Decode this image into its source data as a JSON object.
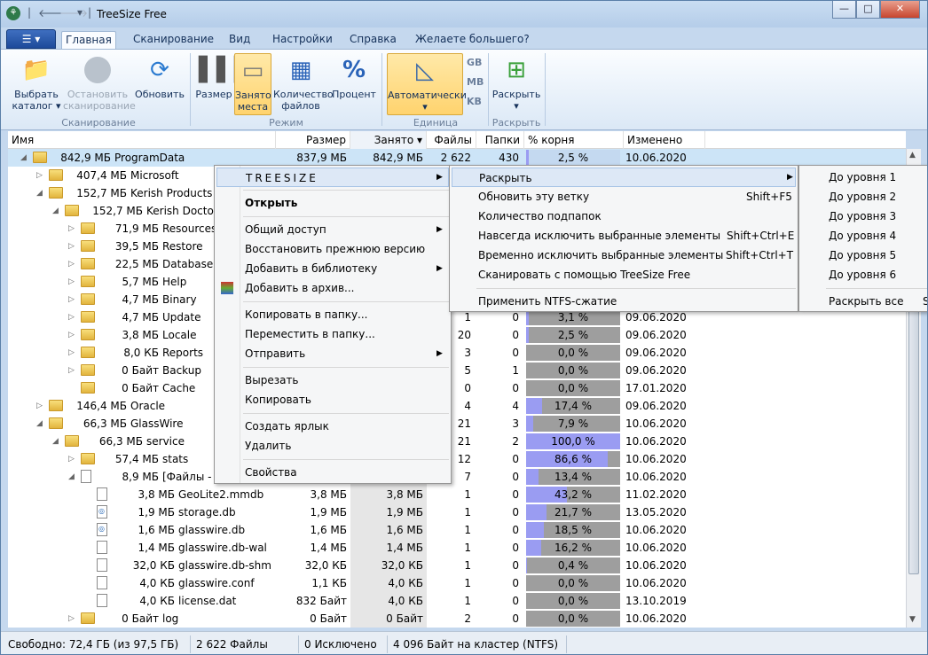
{
  "window": {
    "title": "TreeSize Free",
    "controls": {
      "minimize": "—",
      "maximize": "□",
      "close": "✕"
    }
  },
  "tabs": {
    "file": "☰ ▾",
    "items": [
      "Главная",
      "Сканирование",
      "Вид",
      "Настройки",
      "Справка",
      "Желаете большего?"
    ]
  },
  "ribbon": {
    "select": "Выбрать\nкаталог ▾",
    "stop": "Остановить\nсканирование",
    "refresh": "Обновить",
    "size": "Размер",
    "used": "Занято\nместа",
    "filecount": "Количество\nфайлов",
    "percent": "Процент",
    "auto": "Автоматически\n▾",
    "units": [
      "GB",
      "MB",
      "KB"
    ],
    "expand": "Раскрыть\n▾",
    "groups": {
      "scan": "Сканирование",
      "mode": "Режим",
      "unit": "Единица",
      "expand": "Раскрыть"
    }
  },
  "columns": [
    "Имя",
    "Размер",
    "Занято ▾",
    "Файлы",
    "Папки",
    "% корня (Занято)",
    "Изменено"
  ],
  "rows": [
    {
      "size": "842,9 МБ",
      "name": "ProgramData",
      "s": "837,9 МБ",
      "u": "842,9 МБ",
      "f": "2 622",
      "d": "430",
      "p": "2,5 %",
      "pv": 2.5,
      "m": "10.06.2020",
      "lvl": 0,
      "exp": "◢",
      "t": "folder",
      "sel": true
    },
    {
      "size": "407,4 МБ",
      "name": "Microsoft",
      "lvl": 1,
      "exp": "▷",
      "t": "folder"
    },
    {
      "size": "152,7 МБ",
      "name": "Kerish Products",
      "lvl": 1,
      "exp": "◢",
      "t": "folder"
    },
    {
      "size": "152,7 МБ",
      "name": "Kerish Doctor",
      "lvl": 2,
      "exp": "◢",
      "t": "folder"
    },
    {
      "size": "71,9 МБ",
      "name": "Resources",
      "lvl": 3,
      "exp": "▷",
      "t": "folder"
    },
    {
      "size": "39,5 МБ",
      "name": "Restore",
      "lvl": 3,
      "exp": "▷",
      "t": "folder"
    },
    {
      "size": "22,5 МБ",
      "name": "Database",
      "lvl": 3,
      "exp": "▷",
      "t": "folder"
    },
    {
      "size": "5,7 МБ",
      "name": "Help",
      "lvl": 3,
      "exp": "▷",
      "t": "folder"
    },
    {
      "size": "4,7 МБ",
      "name": "Binary",
      "lvl": 3,
      "exp": "▷",
      "t": "folder"
    },
    {
      "size": "4,7 МБ",
      "name": "Update",
      "f": "1",
      "d": "0",
      "p": "3,1 %",
      "pv": 3.1,
      "m": "09.06.2020",
      "lvl": 3,
      "exp": "▷",
      "t": "folder"
    },
    {
      "size": "3,8 МБ",
      "name": "Locale",
      "f": "20",
      "d": "0",
      "p": "2,5 %",
      "pv": 2.5,
      "m": "09.06.2020",
      "lvl": 3,
      "exp": "▷",
      "t": "folder"
    },
    {
      "size": "8,0 КБ",
      "name": "Reports",
      "f": "3",
      "d": "0",
      "p": "0,0 %",
      "pv": 0,
      "m": "09.06.2020",
      "lvl": 3,
      "exp": "▷",
      "t": "folder"
    },
    {
      "size": "0 Байт",
      "name": "Backup",
      "f": "5",
      "d": "1",
      "p": "0,0 %",
      "pv": 0,
      "m": "09.06.2020",
      "lvl": 3,
      "exp": "▷",
      "t": "folder"
    },
    {
      "size": "0 Байт",
      "name": "Cache",
      "f": "0",
      "d": "0",
      "p": "0,0 %",
      "pv": 0,
      "m": "17.01.2020",
      "lvl": 3,
      "exp": "",
      "t": "folder"
    },
    {
      "size": "146,4 МБ",
      "name": "Oracle",
      "f": "4",
      "d": "4",
      "p": "17,4 %",
      "pv": 17.4,
      "m": "09.06.2020",
      "lvl": 1,
      "exp": "▷",
      "t": "folder"
    },
    {
      "size": "66,3 МБ",
      "name": "GlassWire",
      "f": "21",
      "d": "3",
      "p": "7,9 %",
      "pv": 7.9,
      "m": "10.06.2020",
      "lvl": 1,
      "exp": "◢",
      "t": "folder"
    },
    {
      "size": "66,3 МБ",
      "name": "service",
      "f": "21",
      "d": "2",
      "p": "100,0 %",
      "pv": 100,
      "m": "10.06.2020",
      "lvl": 2,
      "exp": "◢",
      "t": "folder"
    },
    {
      "size": "57,4 МБ",
      "name": "stats",
      "f": "12",
      "d": "0",
      "p": "86,6 %",
      "pv": 86.6,
      "m": "10.06.2020",
      "lvl": 3,
      "exp": "▷",
      "t": "folder"
    },
    {
      "size": "8,9 МБ",
      "name": "[Файлы -",
      "f": "7",
      "d": "0",
      "p": "13,4 %",
      "pv": 13.4,
      "m": "10.06.2020",
      "lvl": 3,
      "exp": "◢",
      "t": "file"
    },
    {
      "size": "3,8 МБ",
      "name": "GeoLite2.mmdb",
      "s": "3,8 МБ",
      "u": "3,8 МБ",
      "f": "1",
      "d": "0",
      "p": "43,2 %",
      "pv": 43.2,
      "m": "11.02.2020",
      "lvl": 4,
      "exp": "",
      "t": "file"
    },
    {
      "size": "1,9 МБ",
      "name": "storage.db",
      "s": "1,9 МБ",
      "u": "1,9 МБ",
      "f": "1",
      "d": "0",
      "p": "21,7 %",
      "pv": 21.7,
      "m": "13.05.2020",
      "lvl": 4,
      "exp": "",
      "t": "db"
    },
    {
      "size": "1,6 МБ",
      "name": "glasswire.db",
      "s": "1,6 МБ",
      "u": "1,6 МБ",
      "f": "1",
      "d": "0",
      "p": "18,5 %",
      "pv": 18.5,
      "m": "10.06.2020",
      "lvl": 4,
      "exp": "",
      "t": "db"
    },
    {
      "size": "1,4 МБ",
      "name": "glasswire.db-wal",
      "s": "1,4 МБ",
      "u": "1,4 МБ",
      "f": "1",
      "d": "0",
      "p": "16,2 %",
      "pv": 16.2,
      "m": "10.06.2020",
      "lvl": 4,
      "exp": "",
      "t": "file"
    },
    {
      "size": "32,0 КБ",
      "name": "glasswire.db-shm",
      "s": "32,0 КБ",
      "u": "32,0 КБ",
      "f": "1",
      "d": "0",
      "p": "0,4 %",
      "pv": 0.4,
      "m": "10.06.2020",
      "lvl": 4,
      "exp": "",
      "t": "file"
    },
    {
      "size": "4,0 КБ",
      "name": "glasswire.conf",
      "s": "1,1 КБ",
      "u": "4,0 КБ",
      "f": "1",
      "d": "0",
      "p": "0,0 %",
      "pv": 0,
      "m": "10.06.2020",
      "lvl": 4,
      "exp": "",
      "t": "file"
    },
    {
      "size": "4,0 КБ",
      "name": "license.dat",
      "s": "832 Байт",
      "u": "4,0 КБ",
      "f": "1",
      "d": "0",
      "p": "0,0 %",
      "pv": 0,
      "m": "13.10.2019",
      "lvl": 4,
      "exp": "",
      "t": "file"
    },
    {
      "size": "0 Байт",
      "name": "log",
      "s": "0 Байт",
      "u": "0 Байт",
      "f": "2",
      "d": "0",
      "p": "0,0 %",
      "pv": 0,
      "m": "10.06.2020",
      "lvl": 3,
      "exp": "▷",
      "t": "folder"
    }
  ],
  "context_menu": {
    "header": "TREESIZE",
    "items": [
      "Открыть",
      "Общий доступ",
      "Восстановить прежнюю версию",
      "Добавить в библиотеку",
      "Добавить в архив...",
      "Копировать в папку...",
      "Переместить в папку...",
      "Отправить",
      "Вырезать",
      "Копировать",
      "Создать ярлык",
      "Удалить",
      "Свойства"
    ]
  },
  "submenu": {
    "items": [
      "Раскрыть",
      "Обновить эту ветку",
      "Количество подпапок",
      "Навсегда исключить выбранные элементы",
      "Временно исключить выбранные элементы",
      "Сканировать с помощью TreeSize Free",
      "Применить NTFS-сжатие"
    ],
    "shortcuts": [
      "",
      "Shift+F5",
      "",
      "Shift+Ctrl+E",
      "Shift+Ctrl+T",
      "",
      ""
    ]
  },
  "submenu2": {
    "items": [
      "До уровня 1",
      "До уровня 2",
      "До уровня 3",
      "До уровня 4",
      "До уровня 5",
      "До уровня 6",
      "Раскрыть все"
    ],
    "extra": "S"
  },
  "status": {
    "free": "Свободно: 72,4 ГБ  (из 97,5 ГБ)",
    "files": "2 622 Файлы",
    "excluded": "0 Исключено",
    "cluster": "4 096 Байт на кластер (NTFS)"
  }
}
